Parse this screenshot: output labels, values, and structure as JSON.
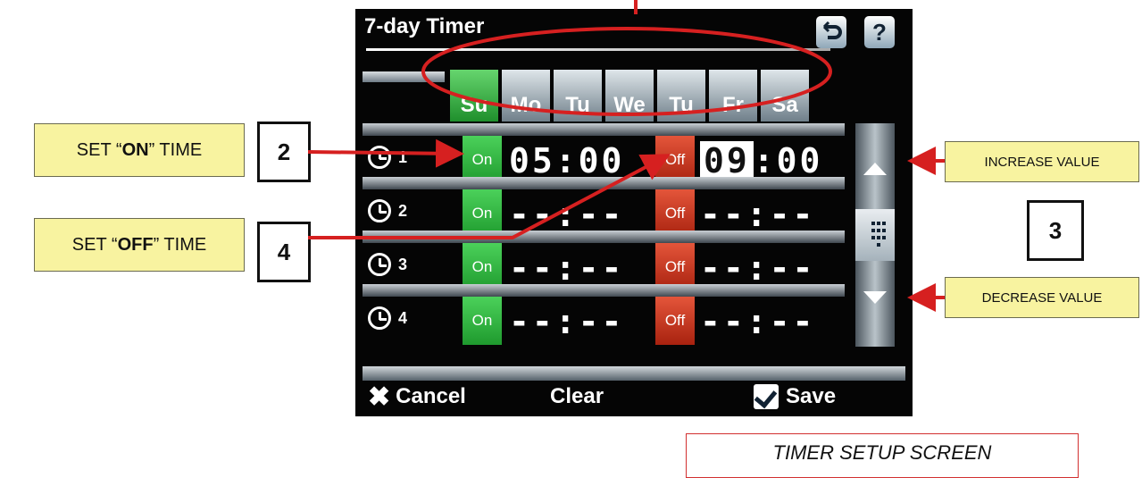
{
  "callouts": {
    "set_on_prefix": "SET “",
    "set_on_bold": "ON",
    "set_on_suffix": "” TIME",
    "set_off_prefix": "SET “",
    "set_off_bold": "OFF",
    "set_off_suffix": "” TIME",
    "increase": "INCREASE VALUE",
    "decrease": "DECREASE VALUE"
  },
  "steps": {
    "two": "2",
    "three": "3",
    "four": "4"
  },
  "caption": "TIMER SETUP SCREEN",
  "screen": {
    "title": "7-day Timer",
    "back_icon": "back-icon",
    "help_label": "?",
    "days": [
      "Su",
      "Mo",
      "Tu",
      "We",
      "Tu",
      "Fr",
      "Sa"
    ],
    "selected_day": "Su",
    "rows": [
      {
        "num": "1",
        "on_label": "On",
        "on_time": "05:00",
        "off_label": "Off",
        "off_hour": "09",
        "off_rest": ":00"
      },
      {
        "num": "2",
        "on_label": "On",
        "on_time": "--:--",
        "off_label": "Off",
        "off_time": "--:--"
      },
      {
        "num": "3",
        "on_label": "On",
        "on_time": "--:--",
        "off_label": "Off",
        "off_time": "--:--"
      },
      {
        "num": "4",
        "on_label": "On",
        "on_time": "--:--",
        "off_label": "Off",
        "off_time": "--:--"
      }
    ],
    "cancel": "Cancel",
    "clear": "Clear",
    "save": "Save",
    "colors": {
      "on": "#2fb43f",
      "off": "#c8371d",
      "selected_day": "#3cbf48",
      "annotation": "#d62020"
    }
  }
}
